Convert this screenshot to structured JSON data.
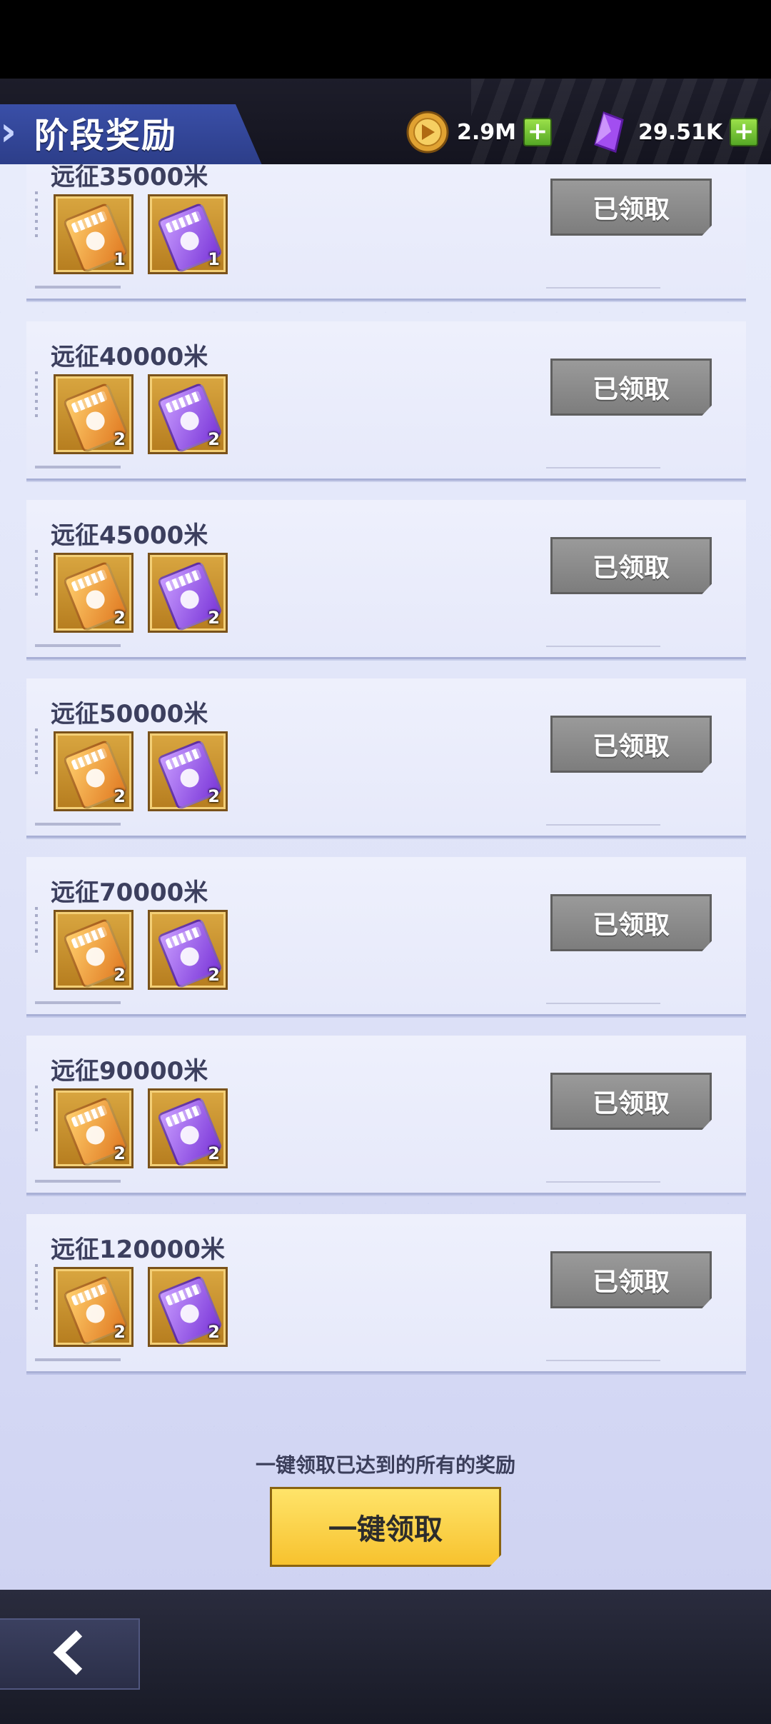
{
  "header": {
    "title": "阶段奖励",
    "currencies": [
      {
        "icon": "gold-coin-icon",
        "amount": "2.9M"
      },
      {
        "icon": "purple-crystal-icon",
        "amount": "29.51K"
      }
    ]
  },
  "stages": [
    {
      "label": "远征35000米",
      "rewards": [
        {
          "icon": "gold-ticket-icon",
          "count": "1"
        },
        {
          "icon": "purple-ticket-icon",
          "count": "1"
        }
      ],
      "button": "已领取"
    },
    {
      "label": "远征40000米",
      "rewards": [
        {
          "icon": "gold-ticket-icon",
          "count": "2"
        },
        {
          "icon": "purple-ticket-icon",
          "count": "2"
        }
      ],
      "button": "已领取"
    },
    {
      "label": "远征45000米",
      "rewards": [
        {
          "icon": "gold-ticket-icon",
          "count": "2"
        },
        {
          "icon": "purple-ticket-icon",
          "count": "2"
        }
      ],
      "button": "已领取"
    },
    {
      "label": "远征50000米",
      "rewards": [
        {
          "icon": "gold-ticket-icon",
          "count": "2"
        },
        {
          "icon": "purple-ticket-icon",
          "count": "2"
        }
      ],
      "button": "已领取"
    },
    {
      "label": "远征70000米",
      "rewards": [
        {
          "icon": "gold-ticket-icon",
          "count": "2"
        },
        {
          "icon": "purple-ticket-icon",
          "count": "2"
        }
      ],
      "button": "已领取"
    },
    {
      "label": "远征90000米",
      "rewards": [
        {
          "icon": "gold-ticket-icon",
          "count": "2"
        },
        {
          "icon": "purple-ticket-icon",
          "count": "2"
        }
      ],
      "button": "已领取"
    },
    {
      "label": "远征120000米",
      "rewards": [
        {
          "icon": "gold-ticket-icon",
          "count": "2"
        },
        {
          "icon": "purple-ticket-icon",
          "count": "2"
        }
      ],
      "button": "已领取"
    }
  ],
  "footer_area": {
    "hint": "一键领取已达到的所有的奖励",
    "claim_all": "一键领取"
  },
  "colors": {
    "claimed_button": "#8c8c8c",
    "claim_all_button": "#f7c22e",
    "header_bg": "#1d1d2a"
  }
}
